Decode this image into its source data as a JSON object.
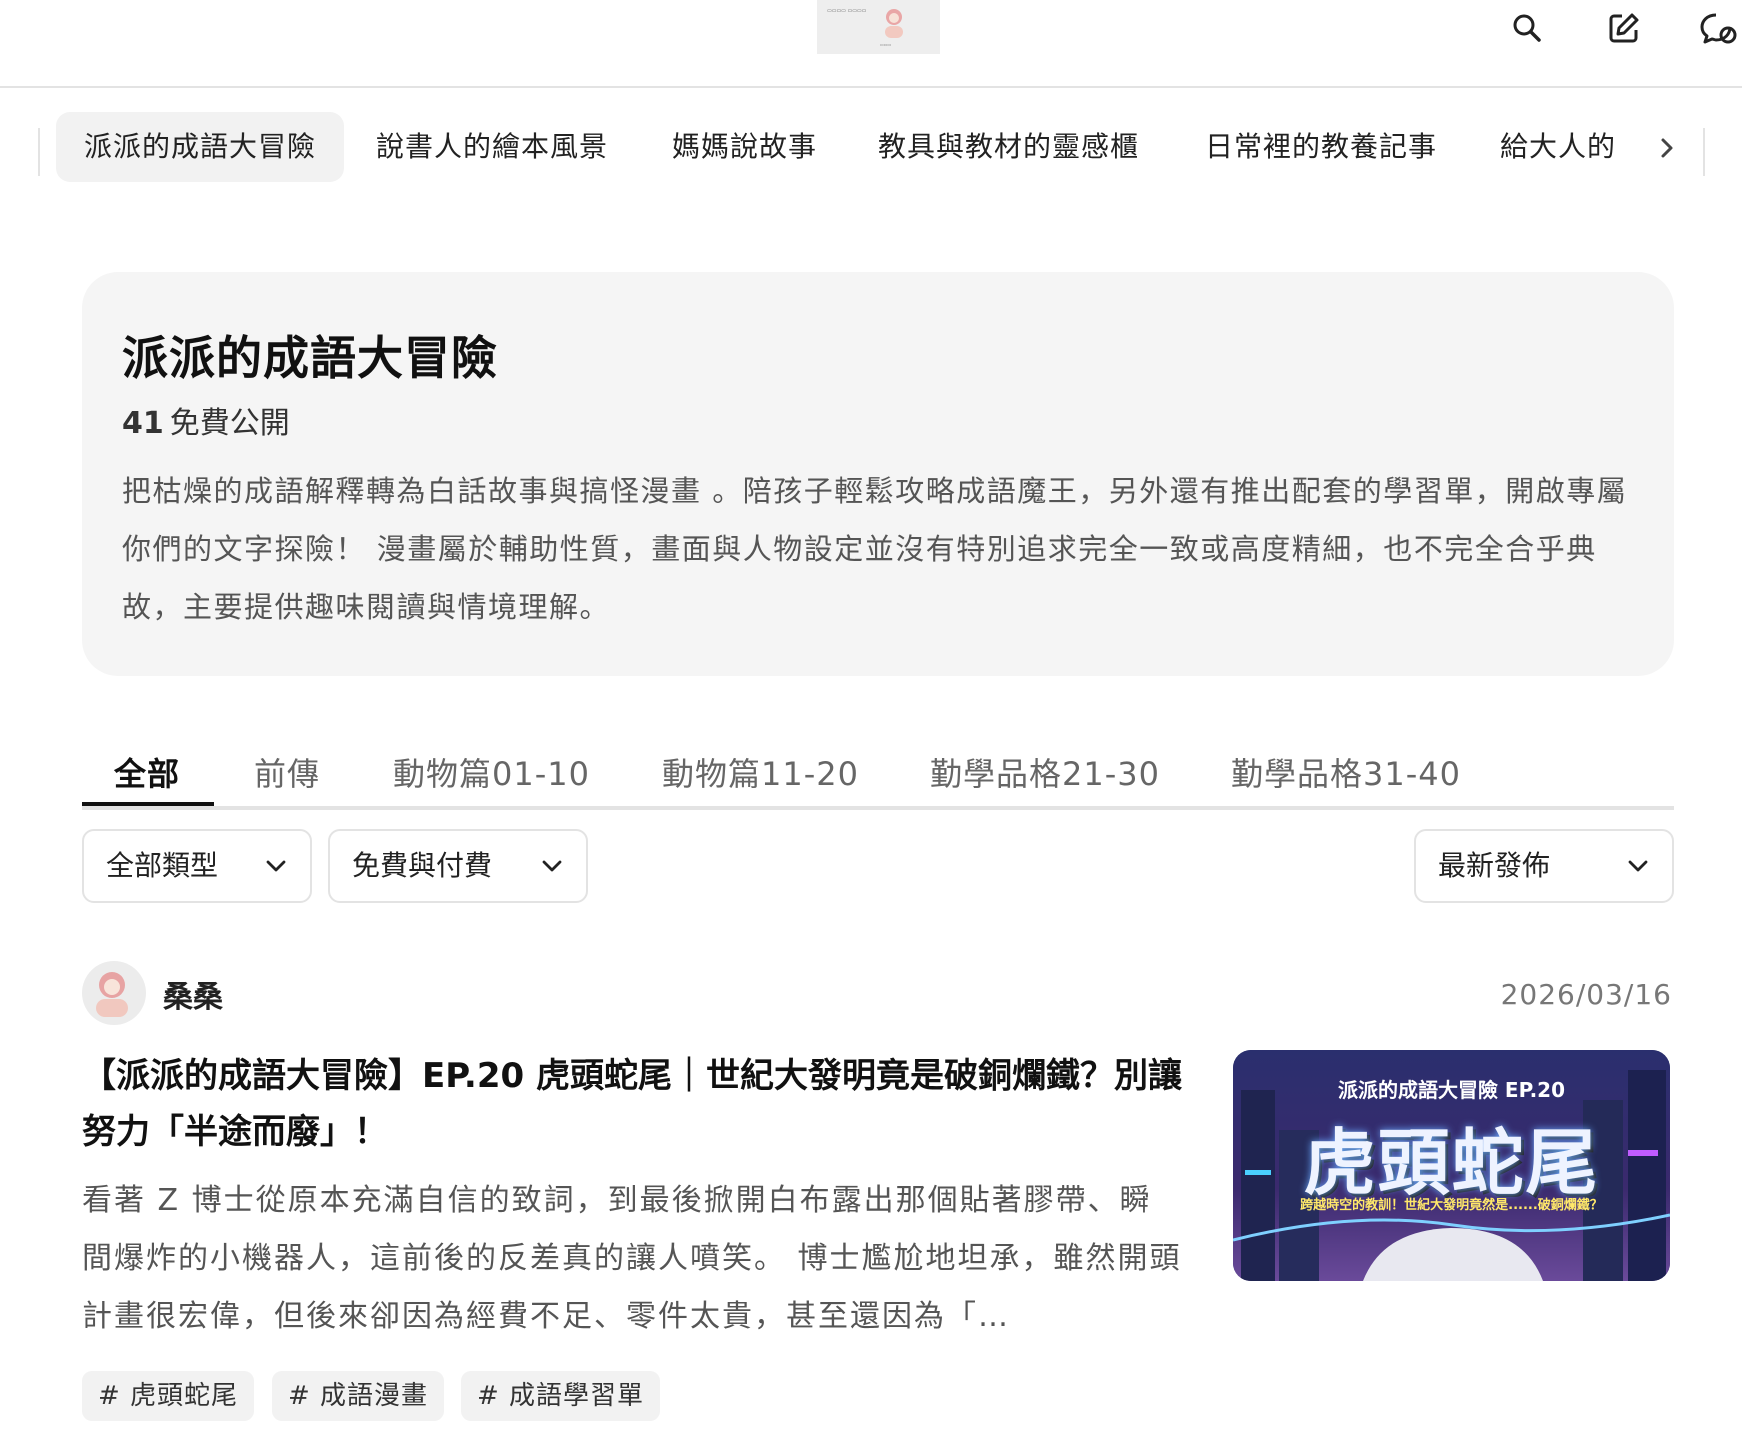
{
  "colors": {
    "accent": "#111111",
    "border": "#e3e3e3",
    "card_bg": "#f5f5f5",
    "chip_bg": "#f2f2f2",
    "muted_text": "#555555"
  },
  "header": {
    "icons": [
      "search-icon",
      "edit-icon",
      "chat-icon"
    ]
  },
  "category_nav": {
    "items": [
      {
        "label": "派派的成語大冒險",
        "active": true
      },
      {
        "label": "說書人的繪本風景",
        "active": false
      },
      {
        "label": "媽媽說故事",
        "active": false
      },
      {
        "label": "教具與教材的靈感櫃",
        "active": false
      },
      {
        "label": "日常裡的教養記事",
        "active": false
      },
      {
        "label": "給大人的",
        "active": false
      }
    ],
    "more_icon": "chevron-right-icon"
  },
  "series": {
    "title": "派派的成語大冒險",
    "count": "41",
    "count_label": "免費公開",
    "description": "把枯燥的成語解釋轉為白話故事與搞怪漫畫 。陪孩子輕鬆攻略成語魔王，另外還有推出配套的學習單，開啟專屬你們的文字探險！ 漫畫屬於輔助性質，畫面與人物設定並沒有特別追求完全一致或高度精細，也不完全合乎典故，主要提供趣味閱讀與情境理解。"
  },
  "tabs": [
    {
      "label": "全部",
      "active": true
    },
    {
      "label": "前傳",
      "active": false
    },
    {
      "label": "動物篇01-10",
      "active": false
    },
    {
      "label": "動物篇11-20",
      "active": false
    },
    {
      "label": "勤學品格21-30",
      "active": false
    },
    {
      "label": "勤學品格31-40",
      "active": false
    }
  ],
  "filters": {
    "type": "全部類型",
    "price": "免費與付費",
    "sort": "最新發佈"
  },
  "post": {
    "author": "桑桑",
    "date": "2026/03/16",
    "title": "【派派的成語大冒險】EP.20 虎頭蛇尾｜世紀大發明竟是破銅爛鐵？別讓努力「半途而廢」！",
    "excerpt": "看著 Z 博士從原本充滿自信的致詞，到最後掀開白布露出那個貼著膠帶、瞬間爆炸的小機器人，這前後的反差真的讓人噴笑。 博士尷尬地坦承，雖然開頭計畫很宏偉，但後來卻因為經費不足、零件太貴，甚至還因為「…",
    "thumbnail": {
      "subtitle": "派派的成語大冒險 EP.20",
      "main": "虎頭蛇尾",
      "tagline": "跨越時空的教訓！世紀大發明竟然是......破銅爛鐵？"
    },
    "tags": [
      "# 虎頭蛇尾",
      "# 成語漫畫",
      "# 成語學習單"
    ]
  }
}
